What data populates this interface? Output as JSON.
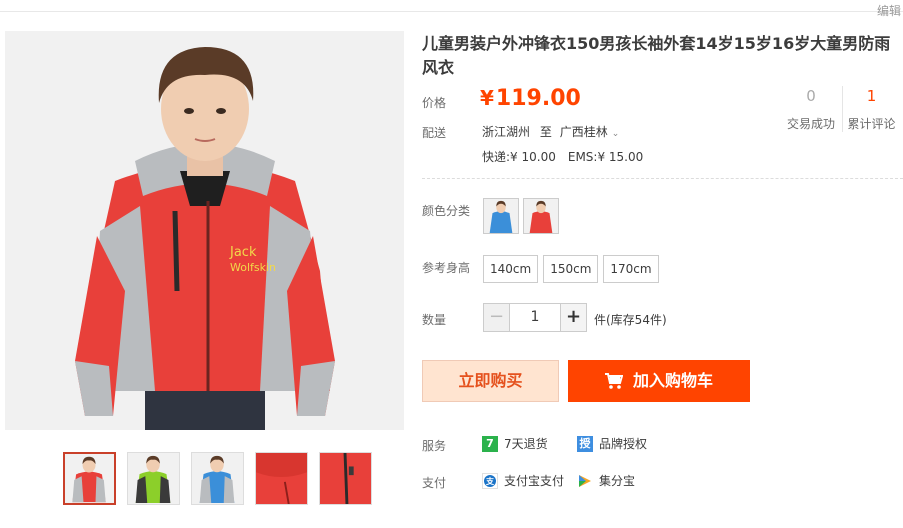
{
  "topbar": {
    "edit_label": "编辑"
  },
  "product": {
    "title": "儿童男装户外冲锋衣150男孩长袖外套14岁15岁16岁大童男防雨风衣",
    "price_label": "价格",
    "price_symbol": "¥",
    "price_value": "119.00",
    "stats": [
      {
        "value": "0",
        "label": "交易成功"
      },
      {
        "value": "1",
        "label": "累计评论"
      }
    ]
  },
  "shipping": {
    "label": "配送",
    "origin": "浙江湖州",
    "to": "至",
    "destination": "广西桂林",
    "express": "快递:¥ 10.00",
    "ems": "EMS:¥ 15.00"
  },
  "options": {
    "color_label": "颜色分类",
    "colors": [
      {
        "name": "blue",
        "hex": "#3b8fd9"
      },
      {
        "name": "red",
        "hex": "#e8403a"
      }
    ],
    "size_label": "参考身高",
    "sizes": [
      "140cm",
      "150cm",
      "170cm"
    ],
    "qty_label": "数量",
    "qty_value": "1",
    "stock_text": "件(库存54件)"
  },
  "actions": {
    "buy_now": "立即购买",
    "add_to_cart": "加入购物车"
  },
  "service": {
    "label": "服务",
    "items": [
      {
        "badge": "7",
        "text": "7天退货"
      },
      {
        "badge": "授",
        "text": "品牌授权"
      }
    ]
  },
  "payment": {
    "label": "支付",
    "items": [
      {
        "icon": "alipay-icon",
        "text": "支付宝支付"
      },
      {
        "icon": "jifenbao-icon",
        "text": "集分宝"
      }
    ]
  },
  "colors": {
    "accent": "#ff4400",
    "jacket_red": "#e8403a",
    "jacket_gray": "#b9bcbf",
    "jacket_blue": "#3b8fd9",
    "jacket_green": "#8ccf2a"
  }
}
